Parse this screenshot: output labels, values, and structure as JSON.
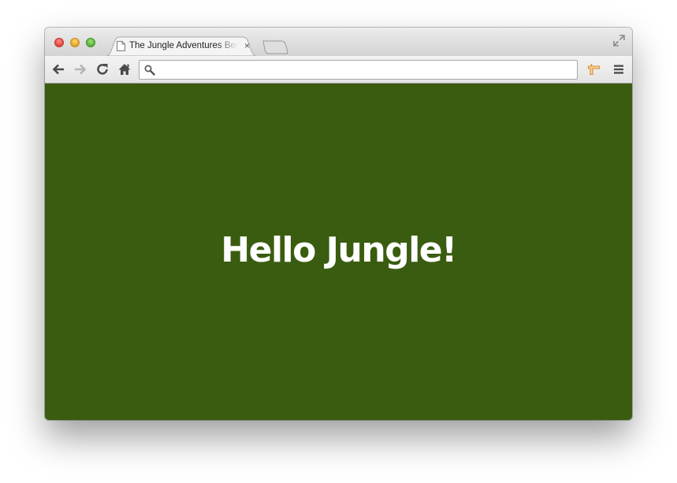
{
  "browser": {
    "tab": {
      "title": "The Jungle Adventures Begin",
      "close_glyph": "×"
    },
    "address_bar": {
      "value": "",
      "placeholder": ""
    },
    "icons": {
      "back": "back-arrow-icon",
      "forward": "forward-arrow-icon",
      "reload": "reload-icon",
      "home": "home-icon",
      "search": "search-icon",
      "extension": "extension-icon",
      "menu": "hamburger-menu-icon",
      "fullscreen": "fullscreen-icon"
    }
  },
  "page": {
    "background_color": "#3a5c10",
    "headline": "Hello Jungle!"
  }
}
